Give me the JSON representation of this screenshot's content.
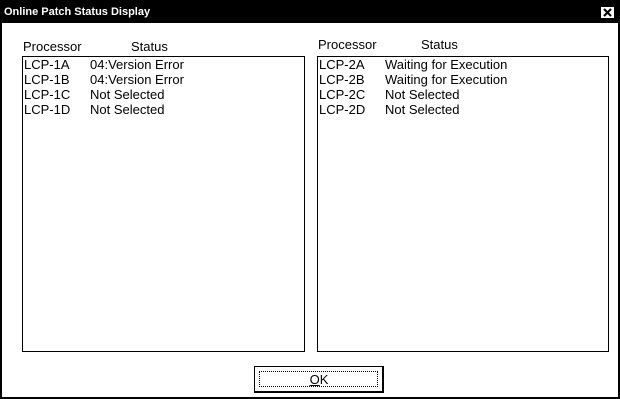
{
  "window": {
    "title": "Online Patch Status Display",
    "close_symbol": "×",
    "close_icon": "close-icon"
  },
  "left_panel": {
    "headers": {
      "processor": "Processor",
      "status": "Status"
    },
    "rows": [
      {
        "processor": "LCP-1A",
        "status": "04:Version Error"
      },
      {
        "processor": "LCP-1B",
        "status": "04:Version Error"
      },
      {
        "processor": "LCP-1C",
        "status": "Not Selected"
      },
      {
        "processor": "LCP-1D",
        "status": "Not Selected"
      }
    ]
  },
  "right_panel": {
    "headers": {
      "processor": "Processor",
      "status": "Status"
    },
    "rows": [
      {
        "processor": "LCP-2A",
        "status": "Waiting for Execution"
      },
      {
        "processor": "LCP-2B",
        "status": "Waiting for Execution"
      },
      {
        "processor": "LCP-2C",
        "status": "Not Selected"
      },
      {
        "processor": "LCP-2D",
        "status": "Not Selected"
      }
    ]
  },
  "buttons": {
    "ok_mnemonic": "O",
    "ok_rest": "K"
  },
  "colors": {
    "title_bar_background": "#000000",
    "title_bar_text": "#ffffff",
    "window_background": "#ffffff",
    "border": "#000000"
  }
}
